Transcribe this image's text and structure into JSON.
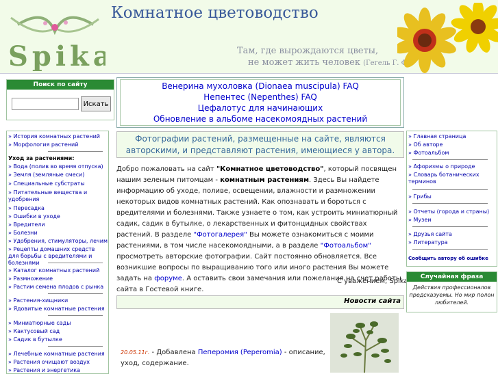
{
  "header": {
    "site_title": "Комнатное цветоводство",
    "quote_line1": "Там, где вырождаются цветы,",
    "quote_line2": "не может жить человек",
    "quote_author": "(Гегель Г. Ф.)",
    "logo_text": "Spika"
  },
  "search": {
    "title": "Поиск по сайту",
    "placeholder": "",
    "button": "Искать"
  },
  "faq_links": [
    "Венерина мухоловка (Dionaea muscipula) FAQ",
    "Непентес (Nepenthes) FAQ",
    "Цефалотус для начинающих",
    "Обновление в альбоме насекомоядных растений"
  ],
  "notice": "Фотографии растений, размещенные на сайте, являются авторскими, и представляют растения, имеющиеся у автора.",
  "left_nav": {
    "group1": [
      "» История комнатных растений",
      "» Морфология растений"
    ],
    "care_heading": "Уход за растениями:",
    "care_items": [
      "» Вода (полив во время отпуска)",
      "» Земля (земляные смеси)",
      "» Специальные субстраты",
      "» Питательные вещества и удобрения",
      "» Пересадка",
      "» Ошибки в уходе",
      "» Вредители",
      "» Болезни",
      "» Удобрения, стимуляторы, лечим",
      "» Рецепты домашних средств для борьбы с вредителями и болезнями"
    ],
    "group3": [
      "» Каталог комнатных растений",
      "» Размножение",
      "» Растим семена плодов с рынка"
    ],
    "group4": [
      "» Растения-хищники",
      "» Ядовитые комнатные растения"
    ],
    "group5": [
      "» Миниатюрные сады",
      "» Кактусовый сад",
      "» Садик в бутылке"
    ],
    "group6": [
      "» Лечебные комнатные растения",
      "» Растения очищают воздух",
      "» Растения и энергетика"
    ]
  },
  "intro": {
    "p1_a": "Добро пожаловать на сайт ",
    "p1_site": "\"Комнатное цветоводство\"",
    "p1_b": ", который посвящен нашим зеленым питомцам  -  ",
    "p1_plants": "комнатным растениям",
    "p1_c": ". Здесь Вы найдете информацию об уходе, поливе, освещении, влажности и размножении некоторых видов комнатных растений. Как опознавать и бороться с вредителями и болезнями. Также узнаете о том, как устроить миниатюрный садик, садик в бутылке, о лекарственных и фитонцидных свойствах растений. В разделе ",
    "p1_gallery": "\"Фотогалерея\"",
    "p1_d": " Вы можете ознакомиться с моими растениями, в том числе насекомоядными, а в разделе ",
    "p1_album": "\"Фотоальбом\"",
    "p1_e": " просмотреть авторские фотографии. Сайт постоянно обновляется. Все возникшие вопросы по выращиванию того или иного растения Вы можете задать на ",
    "p1_forum": "форуме",
    "p1_f": ". А оставить свои замечания или пожелания на счет работы сайта в Гостевой книге.",
    "regards": "С уважением, Spika"
  },
  "news": {
    "title": "Новости сайта",
    "date": "20.05.11г.",
    "text_a": " - Добавлена ",
    "link": "Пеперомия (Peperomia)",
    "text_b": " - описание,",
    "line2": "уход, содержание."
  },
  "right_nav": {
    "group1": [
      "» Главная страница",
      "» Об авторе",
      "» Фотоальбом"
    ],
    "group2": [
      "» Афоризмы о природе",
      "» Словарь ботанических терминов"
    ],
    "group3": [
      "» Грибы"
    ],
    "group4": [
      "» Отчеты (города и страны)",
      "» Музеи"
    ],
    "group5": [
      "» Друзья сайта",
      "» Литература"
    ],
    "contact": "Сообщить автору об ошибке"
  },
  "random": {
    "title": "Случайная фраза",
    "text": "Действия профессионалов предсказуемы. Но мир полон любителей."
  },
  "colors": {
    "accent_green": "#2a8a34",
    "link_blue": "#0000cc",
    "notice_blue": "#336699",
    "header_bg": "#f2fbe9"
  }
}
